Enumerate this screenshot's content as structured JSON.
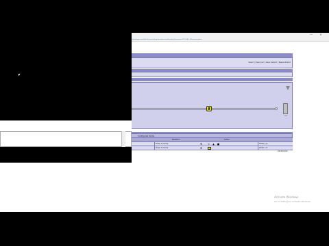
{
  "browser": {
    "url": "http://prototype.local/lab/ui/virtual-lab.jsp?module=track&mode=1&session=192.168.0.10&user=student",
    "minimize_icon": "—",
    "close_icon": "✕"
  },
  "top_panel": {
    "links": "Save? | Clear pos? | Save sliders? | Reset sliders?"
  },
  "track": {
    "caption": "xxxx"
  },
  "configured_items": {
    "title": "Configured items",
    "headers": [
      "",
      "Direction",
      "",
      "Action",
      ""
    ],
    "rows": [
      {
        "direction": "Down to home",
        "action_icons": [
          "move-icon",
          "rotate-icon",
          "warning-icon",
          "save-icon"
        ],
        "status": "status: ok"
      },
      {
        "direction": "Down to home",
        "action_icons": [
          "move-icon",
          "knob-icon"
        ],
        "status": "status: ok"
      }
    ]
  },
  "footer": {
    "note": "2019/01/09"
  },
  "watermark": {
    "line1": "Activate Windows",
    "line2": "Go to Settings to activate Windows."
  },
  "colors": {
    "panel_bg": "#dcdcf0",
    "bar": "#8b8bc8",
    "knob": "#e6e600"
  }
}
